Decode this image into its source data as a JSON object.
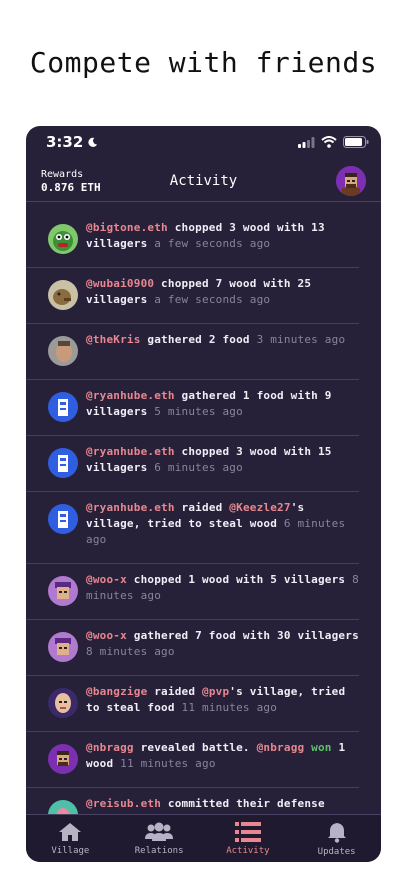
{
  "headline": "Compete with friends",
  "status": {
    "time": "3:32"
  },
  "header": {
    "rewards_label": "Rewards",
    "rewards_value": "0.876 ETH",
    "title": "Activity"
  },
  "feed": [
    {
      "user": "@bigtone.eth",
      "action": " chopped 3 wood with 13 villagers ",
      "time": "a few seconds ago"
    },
    {
      "user": "@wubai0900",
      "action": " chopped 7 wood with 25 villagers ",
      "time": "a few seconds ago"
    },
    {
      "user": "@theKris",
      "action": " gathered 2 food ",
      "time": "3 minutes ago"
    },
    {
      "user": "@ryanhube.eth",
      "action": " gathered 1 food with 9 villagers ",
      "time": "5 minutes ago"
    },
    {
      "user": "@ryanhube.eth",
      "action": " chopped 3 wood with 15 villagers ",
      "time": "6 minutes ago"
    },
    {
      "user": "@ryanhube.eth",
      "action": " raided ",
      "target": "@Keezle27",
      "action2": "'s village, tried to steal wood ",
      "time": "6 minutes ago"
    },
    {
      "user": "@woo-x",
      "action": " chopped 1 wood with 5 villagers ",
      "time": "8 minutes ago"
    },
    {
      "user": "@woo-x",
      "action": " gathered 7 food with 30 villagers ",
      "time": "8 minutes ago"
    },
    {
      "user": "@bangzige",
      "action": " raided ",
      "target": "@pvp",
      "action2": "'s village, tried to steal food ",
      "time": "11 minutes ago"
    },
    {
      "user": "@nbragg",
      "action": " revealed battle. ",
      "target": "@nbragg",
      "won": " won",
      "action2": " 1 wood ",
      "time": "11 minutes ago"
    },
    {
      "user": "@reisub.eth",
      "action": " committed their defense",
      "time": ""
    }
  ],
  "tabs": [
    {
      "label": "Village",
      "icon": "home-icon"
    },
    {
      "label": "Relations",
      "icon": "people-icon"
    },
    {
      "label": "Activity",
      "icon": "list-icon"
    },
    {
      "label": "Updates",
      "icon": "bell-icon"
    }
  ],
  "colors": {
    "background": "#272039",
    "accent": "#e8878f",
    "won": "#5ec26a",
    "muted": "#8a8499"
  }
}
